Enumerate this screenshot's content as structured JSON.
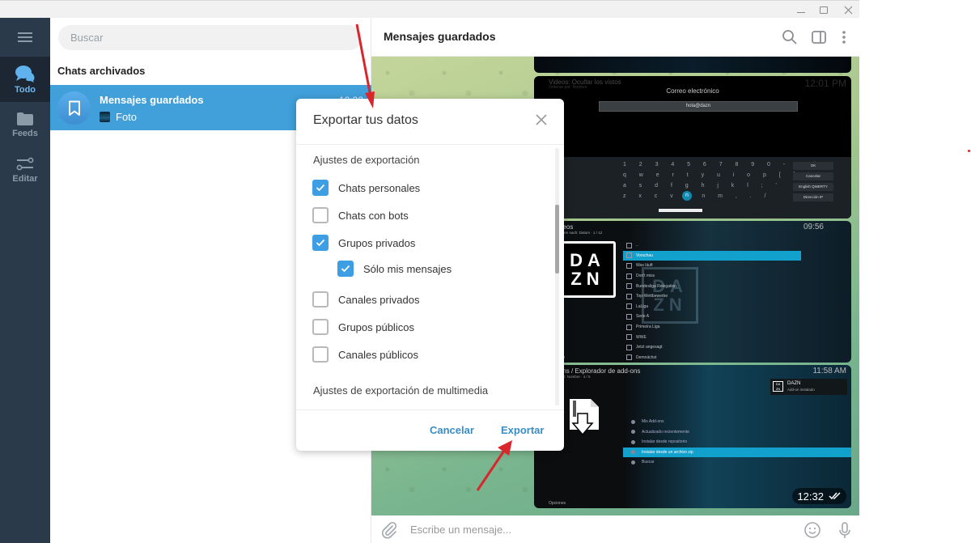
{
  "window": {
    "controls": [
      "minimize",
      "maximize",
      "close"
    ]
  },
  "rail": {
    "menu_icon": "hamburger-icon",
    "items": [
      {
        "label": "Todo",
        "icon": "chat-bubbles-icon",
        "active": true
      },
      {
        "label": "Feeds",
        "icon": "folder-icon",
        "active": false
      },
      {
        "label": "Editar",
        "icon": "sliders-icon",
        "active": false
      }
    ]
  },
  "chatlist": {
    "search_placeholder": "Buscar",
    "archived_label": "Chats archivados",
    "chats": [
      {
        "name": "Mensajes guardados",
        "preview": "Foto",
        "time": "12:32",
        "icon": "bookmark-icon",
        "selected": true
      }
    ]
  },
  "conversation": {
    "title": "Mensajes guardados",
    "header_icons": [
      "search-icon",
      "sidebar-toggle-icon",
      "more-vertical-icon"
    ],
    "composer_placeholder": "Escribe un mensaje...",
    "composer_icons": [
      "attach-icon",
      "emoji-icon",
      "microphone-icon"
    ],
    "message_time": "12:32",
    "message_status": "read",
    "photos": {
      "keyboard": {
        "title": "Videos: Ocultar los vistos",
        "subtitle": "Ordenar por: Nombre",
        "clock": "12:01 PM",
        "field_label": "Correo electrónico",
        "field_value": "hola@dazn",
        "rows": [
          "1  2  3  4  5  6  7  8  9  0  -  =  `",
          "q  w  e  r  t  y  u  i  o  p  [  ]  \\",
          "a  s  d  f  g  h  j  k  l  ;  '",
          "z  x  c  v  b  n  m  ,  .  /"
        ],
        "side_buttons": [
          "OK",
          "Cancelar",
          "English QWERTY",
          "Dirección IP"
        ]
      },
      "videos": {
        "title": "Videos",
        "subtitle": "Sortieren nach: Datum · 1 / 12",
        "clock": "09:56",
        "logo": [
          "DA",
          "ZN"
        ],
        "items": [
          "..",
          "Vorschau",
          "Was läuft",
          "Don't miss",
          "Bundesliga Relegation",
          "Top-Wettbewerbe",
          "LaLiga",
          "Serie A",
          "Primeira Liga",
          "WWE",
          "Jetzt angesagt",
          "Demnächst"
        ],
        "selected_index": 1,
        "options_label": "Optionen"
      },
      "addons": {
        "title": "Add-ons / Explorador de add-ons",
        "subtitle": "Ordenar por: Nombre · 4 / 5",
        "clock": "11:58 AM",
        "notice_title": "DAZN",
        "notice_text": "Add-on instalado",
        "items": [
          "Mis Add-ons",
          "Actualizado recientemente",
          "Instalar desde repositorio",
          "Instalar desde un archivo zip",
          "Buscar"
        ],
        "selected_index": 3,
        "options_label": "Opciones"
      }
    }
  },
  "dialog": {
    "title": "Exportar tus datos",
    "section_export": "Ajustes de exportación",
    "options": [
      {
        "label": "Chats personales",
        "checked": true,
        "indent": false
      },
      {
        "label": "Chats con bots",
        "checked": false,
        "indent": false
      },
      {
        "label": "Grupos privados",
        "checked": true,
        "indent": false
      },
      {
        "label": "Sólo mis mensajes",
        "checked": true,
        "indent": true
      },
      {
        "label": "Canales privados",
        "checked": false,
        "indent": false
      },
      {
        "label": "Grupos públicos",
        "checked": false,
        "indent": false
      },
      {
        "label": "Canales públicos",
        "checked": false,
        "indent": false
      }
    ],
    "section_media": "Ajustes de exportación de multimedia",
    "cancel_label": "Cancelar",
    "export_label": "Exportar"
  },
  "colors": {
    "accent": "#419fd9",
    "checkbox_on": "#3e9ee3",
    "rail_bg": "#2b3a4a",
    "rail_active": "#1d2733",
    "button_text": "#3a8dc4",
    "annotation": "#d9262c"
  }
}
